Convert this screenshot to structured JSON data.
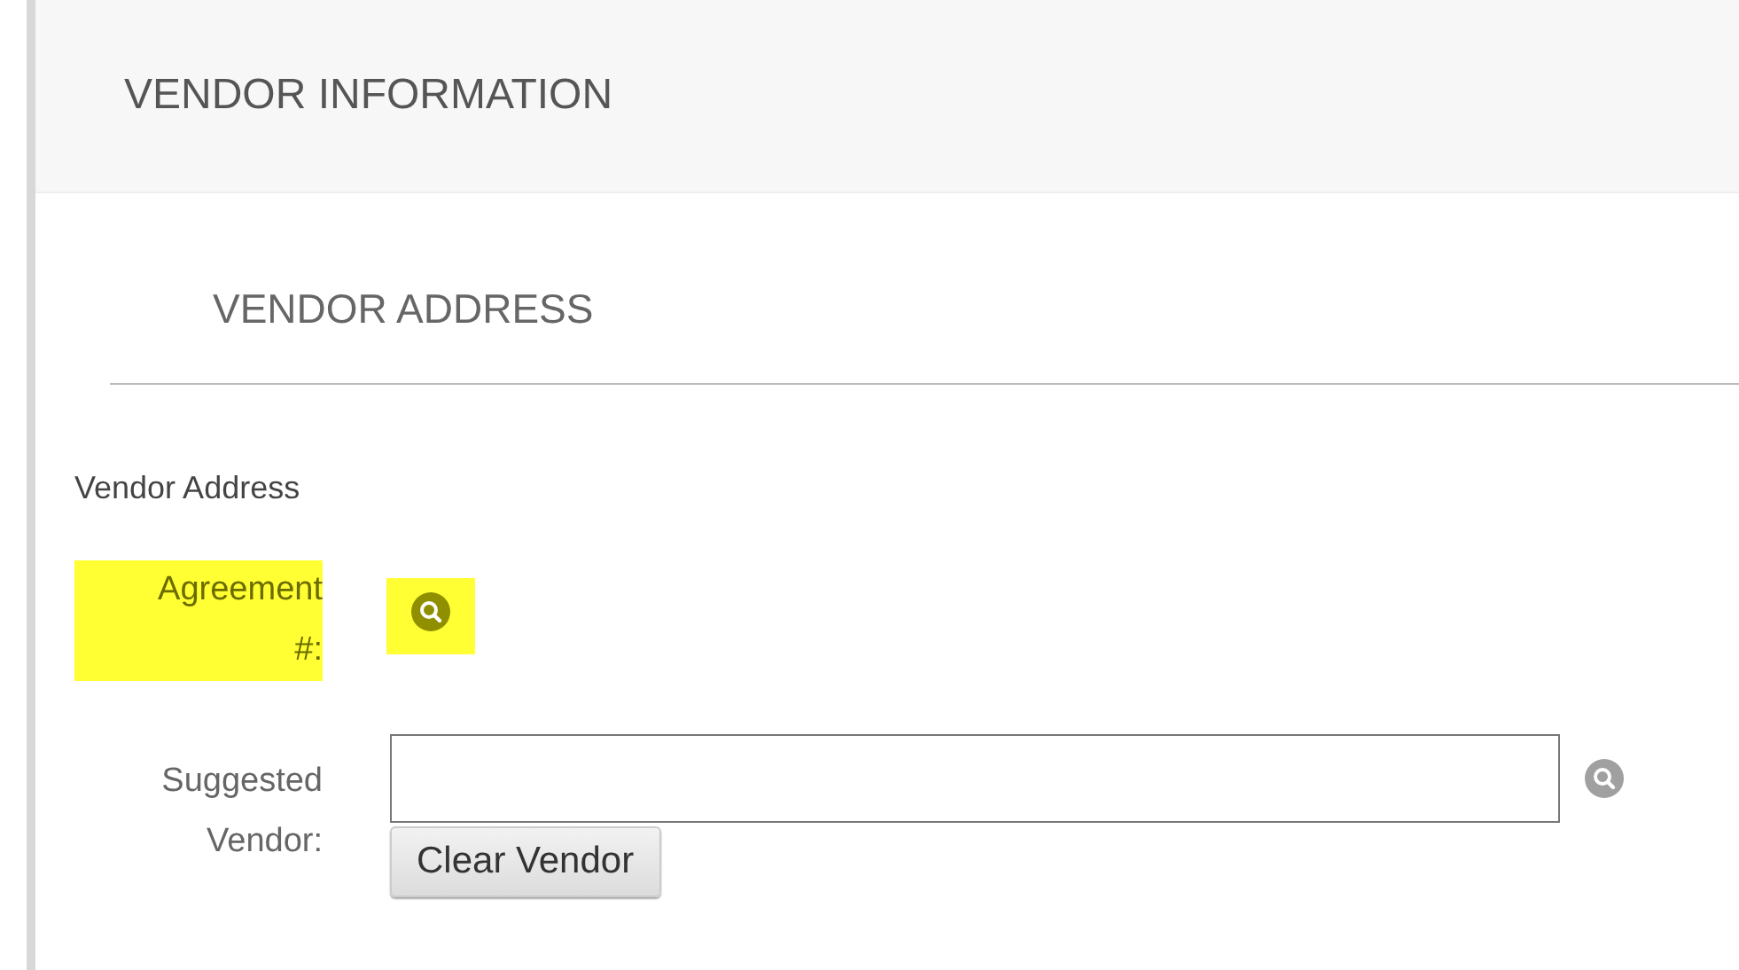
{
  "section": {
    "title": "VENDOR INFORMATION"
  },
  "subsection": {
    "title": "VENDOR ADDRESS"
  },
  "group_label": "Vendor Address",
  "fields": [
    {
      "kind": "lookup",
      "label": "Agreement #:",
      "highlighted": true
    },
    {
      "kind": "input",
      "label": "Suggested Vendor:",
      "highlighted": false,
      "button": "Clear Vendor"
    }
  ]
}
